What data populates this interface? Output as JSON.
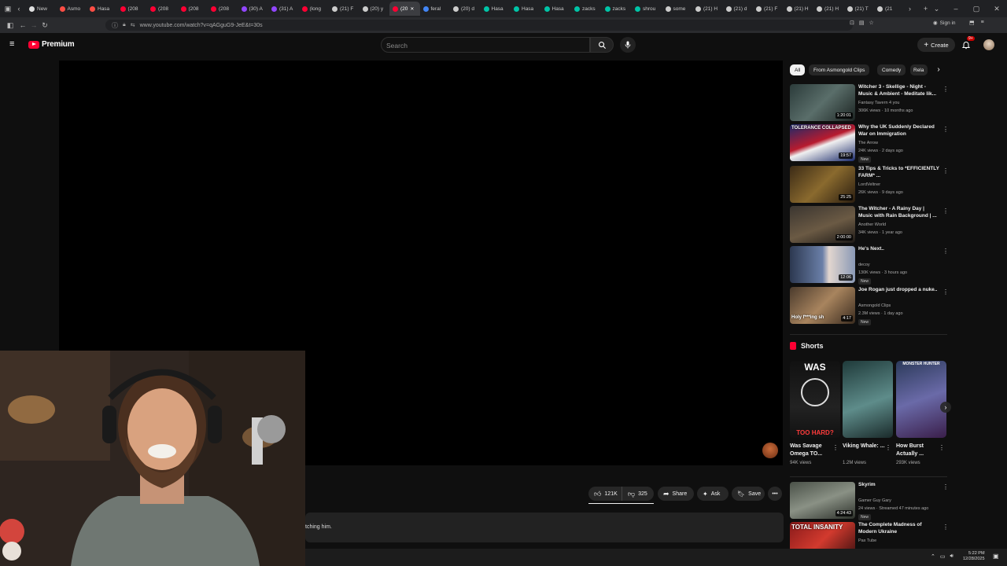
{
  "browser": {
    "tabs": [
      {
        "label": "New",
        "color": "#e0e0e0"
      },
      {
        "label": "Asmo",
        "color": "#ff4e45"
      },
      {
        "label": "Hasa",
        "color": "#ff4e45"
      },
      {
        "label": "(208",
        "color": "#ff0033"
      },
      {
        "label": "(208",
        "color": "#ff0033"
      },
      {
        "label": "(208",
        "color": "#ff0033"
      },
      {
        "label": "(208",
        "color": "#ff0033"
      },
      {
        "label": "(30) A",
        "color": "#9146ff"
      },
      {
        "label": "(31) A",
        "color": "#9146ff"
      },
      {
        "label": "(long",
        "color": "#ff0033"
      },
      {
        "label": "(21) F",
        "color": "#cccccc"
      },
      {
        "label": "(20) y",
        "color": "#cccccc"
      },
      {
        "label": "(20",
        "color": "#ff0033",
        "active": true
      },
      {
        "label": "feral",
        "color": "#4285f4"
      },
      {
        "label": "(20) d",
        "color": "#cccccc"
      },
      {
        "label": "Hasa",
        "color": "#00c4a7"
      },
      {
        "label": "Hasa",
        "color": "#00c4a7"
      },
      {
        "label": "Hasa",
        "color": "#00c4a7"
      },
      {
        "label": "zacks",
        "color": "#00c4a7"
      },
      {
        "label": "zacks",
        "color": "#00c4a7"
      },
      {
        "label": "shrou",
        "color": "#00c4a7"
      },
      {
        "label": "some",
        "color": "#cccccc"
      },
      {
        "label": "(21) H",
        "color": "#cccccc"
      },
      {
        "label": "(21) d",
        "color": "#cccccc"
      },
      {
        "label": "(21) F",
        "color": "#cccccc"
      },
      {
        "label": "(21) H",
        "color": "#cccccc"
      },
      {
        "label": "(21) H",
        "color": "#cccccc"
      },
      {
        "label": "(21) T",
        "color": "#cccccc"
      },
      {
        "label": "(21",
        "color": "#cccccc"
      }
    ],
    "url": "www.youtube.com/watch?v=qAGguG9-JeE&t=30s",
    "sign_in": "Sign in"
  },
  "masthead": {
    "brand": "Premium",
    "search_placeholder": "Search",
    "create": "Create",
    "notif_count": "9+"
  },
  "actions": {
    "likes": "121K",
    "dislikes": "325",
    "share": "Share",
    "ask": "Ask",
    "save": "Save"
  },
  "description_snippet": "tching him.",
  "chips": [
    "All",
    "From Asmongold Clips",
    "Comedy",
    "Rela"
  ],
  "recommendations": [
    {
      "title": "Witcher 3 - Skellige - Night - Music & Ambient - Meditate lik...",
      "channel": "Fantasy Tavern 4 you",
      "meta": "306K views · 10 months ago",
      "duration": "1:20:01",
      "new": false,
      "thumb": "linear-gradient(135deg,#2b3b3a,#5a6e6a 50%,#1c2422)"
    },
    {
      "title": "Why the UK Suddenly Declared War on Immigration",
      "channel": "The Arrow",
      "meta": "24K views · 2 days ago",
      "duration": "19:57",
      "new": true,
      "new_label": "New",
      "thumb": "linear-gradient(160deg,#1a2a6b 0%,#b81b2e 45%,#f0f0f0 55%,#1a2a6b 100%)",
      "thumb_text": "TOLERANCE COLLAPSED"
    },
    {
      "title": "33 Tips & Tricks to *EFFICIENTLY FARM* ...",
      "channel": "LordVeltner",
      "meta": "26K views · 9 days ago",
      "duration": "25:25",
      "new": false,
      "thumb": "linear-gradient(135deg,#3b2a16,#8a6a2e 50%,#2a1d10)"
    },
    {
      "title": "The Witcher - A Rainy Day | Music with Rain Background | ...",
      "channel": "Another World",
      "meta": "34K views · 1 year ago",
      "duration": "2:00:00",
      "new": false,
      "thumb": "linear-gradient(160deg,#3a3530,#6b5a44 55%,#1e1a17)"
    },
    {
      "title": "He's Next..",
      "channel": "decoy",
      "meta": "130K views · 3 hours ago",
      "duration": "12:06",
      "new": true,
      "new_label": "New",
      "thumb": "linear-gradient(90deg,#2c3850 0%,#6a7fa8 50%,#e2d6cf 60%,#8a99b5 100%)"
    },
    {
      "title": "Joe Rogan just dropped a nuke..",
      "channel": "Asmongold Clips",
      "meta": "2.3M views · 1 day ago",
      "duration": "4:17",
      "new": true,
      "new_label": "New",
      "thumb": "linear-gradient(135deg,#4a3a2c,#a8845e 50%,#3a2b1e)",
      "thumb_text": "Holy f***ing sh"
    },
    {
      "title": "Skyrim",
      "channel": "Gamer Guy Gary",
      "meta": "24 views · Streamed 47 minutes ago",
      "duration": "4:24:43",
      "new": true,
      "new_label": "New",
      "thumb": "linear-gradient(160deg,#4a5148,#8a9185 50%,#2c302a)"
    },
    {
      "title": "The Complete Madness of Modern Ukraine",
      "channel": "Pax Tube",
      "meta": "",
      "duration": "",
      "new": false,
      "thumb": "linear-gradient(135deg,#8a1b1b,#d23a2e 50%,#3a0f0f)",
      "thumb_text": "TOTAL INSANITY"
    }
  ],
  "shorts": {
    "heading": "Shorts",
    "items": [
      {
        "title": "Was Savage Omega TO...",
        "views": "94K views",
        "thumb": "linear-gradient(180deg,#111 0%,#222 60%,#111 100%)",
        "top": "WAS",
        "bottom": "TOO HARD?"
      },
      {
        "title": "Viking Whale: ...",
        "views": "1.2M views",
        "thumb": "linear-gradient(160deg,#1f3a3a,#5e8c8a 55%,#1a2a2a)"
      },
      {
        "title": "How Burst Actually ...",
        "views": "293K views",
        "thumb": "linear-gradient(160deg,#2b3a5a,#6a6aa8 50%,#3a1e4a)",
        "top": "MONSTER HUNTER"
      }
    ]
  },
  "taskbar": {
    "time": "5:22 PM",
    "date": "12/28/2025"
  }
}
